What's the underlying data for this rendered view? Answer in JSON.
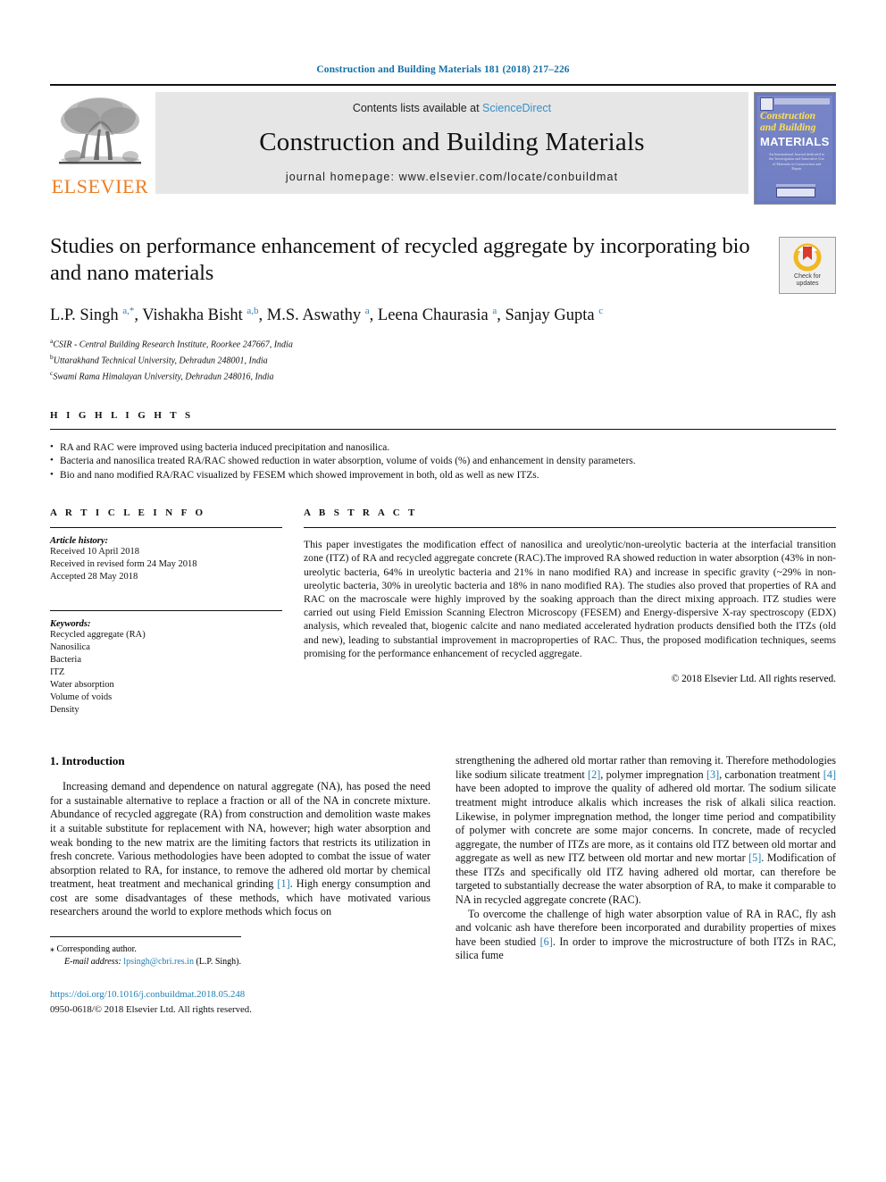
{
  "running_head": "Construction and Building Materials 181 (2018) 217–226",
  "masthead": {
    "publisher": "ELSEVIER",
    "contents_prefix": "Contents lists available at ",
    "sciencedirect": "ScienceDirect",
    "journal_name": "Construction and Building Materials",
    "homepage": "journal homepage: www.elsevier.com/locate/conbuildmat",
    "cover": {
      "line1": "Construction",
      "line2": "and Building",
      "line3": "MATERIALS",
      "subtitle": "An International Journal dedicated to the Investigation and Innovative Use of Materials in Construction and Repair"
    }
  },
  "article": {
    "title": "Studies on performance enhancement of recycled aggregate by incorporating bio and nano materials",
    "authors_html": "L.P. Singh <sup>a,</sup><sup>*</sup>, Vishakha Bisht <sup>a,b</sup>, M.S. Aswathy <sup>a</sup>, Leena Chaurasia <sup>a</sup>, Sanjay Gupta <sup>c</sup>",
    "affiliations": [
      {
        "marker": "a",
        "text": "CSIR - Central Building Research Institute, Roorkee 247667, India"
      },
      {
        "marker": "b",
        "text": "Uttarakhand Technical University, Dehradun 248001, India"
      },
      {
        "marker": "c",
        "text": "Swami Rama Himalayan University, Dehradun 248016, India"
      }
    ],
    "crossmark": {
      "line1": "Check for",
      "line2": "updates"
    }
  },
  "highlights": {
    "heading": "H I G H L I G H T S",
    "items": [
      "RA and RAC were improved using bacteria induced precipitation and nanosilica.",
      "Bacteria and nanosilica treated RA/RAC showed reduction in water absorption, volume of voids (%) and enhancement in density parameters.",
      "Bio and nano modified RA/RAC visualized by FESEM which showed improvement in both, old as well as new ITZs."
    ]
  },
  "article_info": {
    "heading": "A R T I C L E    I N F O",
    "history_label": "Article history:",
    "history": [
      "Received 10 April 2018",
      "Received in revised form 24 May 2018",
      "Accepted 28 May 2018"
    ],
    "keywords_label": "Keywords:",
    "keywords": [
      "Recycled aggregate (RA)",
      "Nanosilica",
      "Bacteria",
      "ITZ",
      "Water absorption",
      "Volume of voids",
      "Density"
    ]
  },
  "abstract": {
    "heading": "A B S T R A C T",
    "text": "This paper investigates the modification effect of nanosilica and ureolytic/non-ureolytic bacteria at the interfacial transition zone (ITZ) of RA and recycled aggregate concrete (RAC).The improved RA showed reduction in water absorption (43% in non-ureolytic bacteria, 64% in ureolytic bacteria and 21% in nano modified RA) and increase in specific gravity (~29% in non-ureolytic bacteria, 30% in ureolytic bacteria and 18% in nano modified RA). The studies also proved that properties of RA and RAC on the macroscale were highly improved by the soaking approach than the direct mixing approach. ITZ studies were carried out using Field Emission Scanning Electron Microscopy (FESEM) and Energy-dispersive X-ray spectroscopy (EDX) analysis, which revealed that, biogenic calcite and nano mediated accelerated hydration products densified both the ITZs (old and new), leading to substantial improvement in macroproperties of RAC. Thus, the proposed modification techniques, seems promising for the performance enhancement of recycled aggregate.",
    "copyright": "© 2018 Elsevier Ltd. All rights reserved."
  },
  "body": {
    "section_title": "1. Introduction",
    "left_paragraph_1": "Increasing demand and dependence on natural aggregate (NA), has posed the need for a sustainable alternative to replace a fraction or all of the NA in concrete mixture. Abundance of recycled aggregate (RA) from construction and demolition waste makes it a suitable substitute for replacement with NA, however; high water absorption and weak bonding to the new matrix are the limiting factors that restricts its utilization in fresh concrete. Various methodologies have been adopted to combat the issue of water absorption related to RA, for instance, to remove the adhered old mortar by chemical treatment, heat treatment and mechanical grinding [1]. High energy consumption and cost are some disadvantages of these methods, which have motivated various researchers around the world to explore methods which focus on",
    "right_paragraph_1": "strengthening the adhered old mortar rather than removing it. Therefore methodologies like sodium silicate treatment [2], polymer impregnation [3], carbonation treatment [4] have been adopted to improve the quality of adhered old mortar. The sodium silicate treatment might introduce alkalis which increases the risk of alkali silica reaction. Likewise, in polymer impregnation method, the longer time period and compatibility of polymer with concrete are some major concerns. In concrete, made of recycled aggregate, the number of ITZs are more, as it contains old ITZ between old mortar and aggregate as well as new ITZ between old mortar and new mortar [5]. Modification of these ITZs and specifically old ITZ having adhered old mortar, can therefore be targeted to substantially decrease the water absorption of RA, to make it comparable to NA in recycled aggregate concrete (RAC).",
    "right_paragraph_2": "To overcome the challenge of high water absorption value of RA in RAC, fly ash and volcanic ash have therefore been incorporated and durability properties of mixes have been studied [6]. In order to improve the microstructure of both ITZs in RAC, silica fume"
  },
  "footer": {
    "corresponding_marker": "⁎",
    "corresponding_label": "Corresponding author.",
    "email_label": "E-mail address:",
    "email": "lpsingh@cbri.res.in",
    "email_owner": "(L.P. Singh).",
    "doi": "https://doi.org/10.1016/j.conbuildmat.2018.05.248",
    "issn": "0950-0618/© 2018 Elsevier Ltd. All rights reserved."
  },
  "colors": {
    "link": "#1f7fb5",
    "running_head": "#1070a8",
    "elsevier_orange": "#ef7d22",
    "sciencedirect": "#3a8fc4",
    "banner_gray": "#e6e6e6"
  }
}
